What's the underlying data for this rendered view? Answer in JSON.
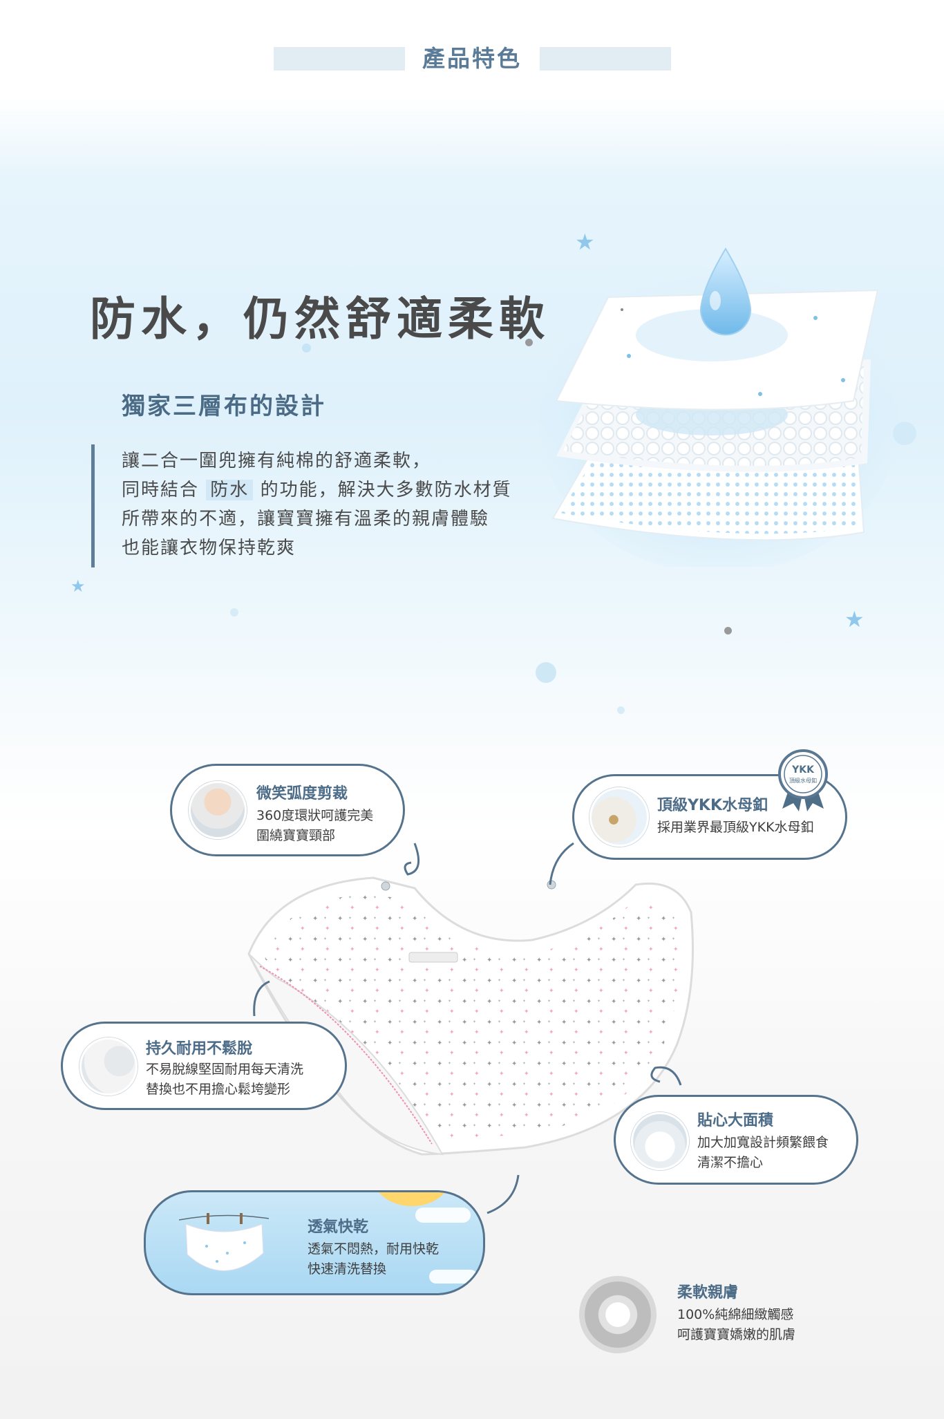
{
  "header": {
    "title": "產品特色"
  },
  "hero": {
    "title": "防水，仍然舒適柔軟",
    "subtitle": "獨家三層布的設計",
    "body": {
      "line1": "讓二合一圍兜擁有純棉的舒適柔軟，",
      "line2_before": "同時結合",
      "line2_highlight": "防水",
      "line2_after": "的功能，解決大多數防水材質",
      "line3": "所帶來的不適，讓寶寶擁有溫柔的親膚體驗",
      "line4": "也能讓衣物保持乾爽"
    }
  },
  "features": {
    "smile": {
      "title": "微笑弧度剪裁",
      "line1": "360度環狀呵護完美",
      "line2": "圍繞寶寶頸部",
      "icon": "baby-photo-icon"
    },
    "ykk": {
      "title": "頂級YKK水母釦",
      "line1": "採用業界最頂級YKK水母釦",
      "icon": "snap-button-icon",
      "badge_top": "YKK",
      "badge_bottom": "頂級水母釦"
    },
    "durable": {
      "title": "持久耐用不鬆脫",
      "line1": "不易脫線堅固耐用每天清洗",
      "line2": "替換也不用擔心鬆垮變形",
      "icon": "stitch-closeup-icon"
    },
    "large": {
      "title": "貼心大面積",
      "line1": "加大加寬設計頻繁餵食",
      "line2": "清潔不擔心",
      "icon": "baby-wearing-bib-icon"
    },
    "breathable": {
      "title": "透氣快乾",
      "line1": "透氣不悶熱，耐用快乾",
      "line2": "快速清洗替換",
      "icon": "drying-bib-icon"
    },
    "soft": {
      "title": "柔軟親膚",
      "line1": "100%純綿細緻觸感",
      "line2": "呵護寶寶嬌嫩的肌膚",
      "icon": "cotton-flower-icon"
    }
  },
  "colors": {
    "accent": "#55738c",
    "title_blue": "#4d6c88",
    "highlight": "#d2e8f6",
    "pink_stitch": "#f08fb0"
  }
}
